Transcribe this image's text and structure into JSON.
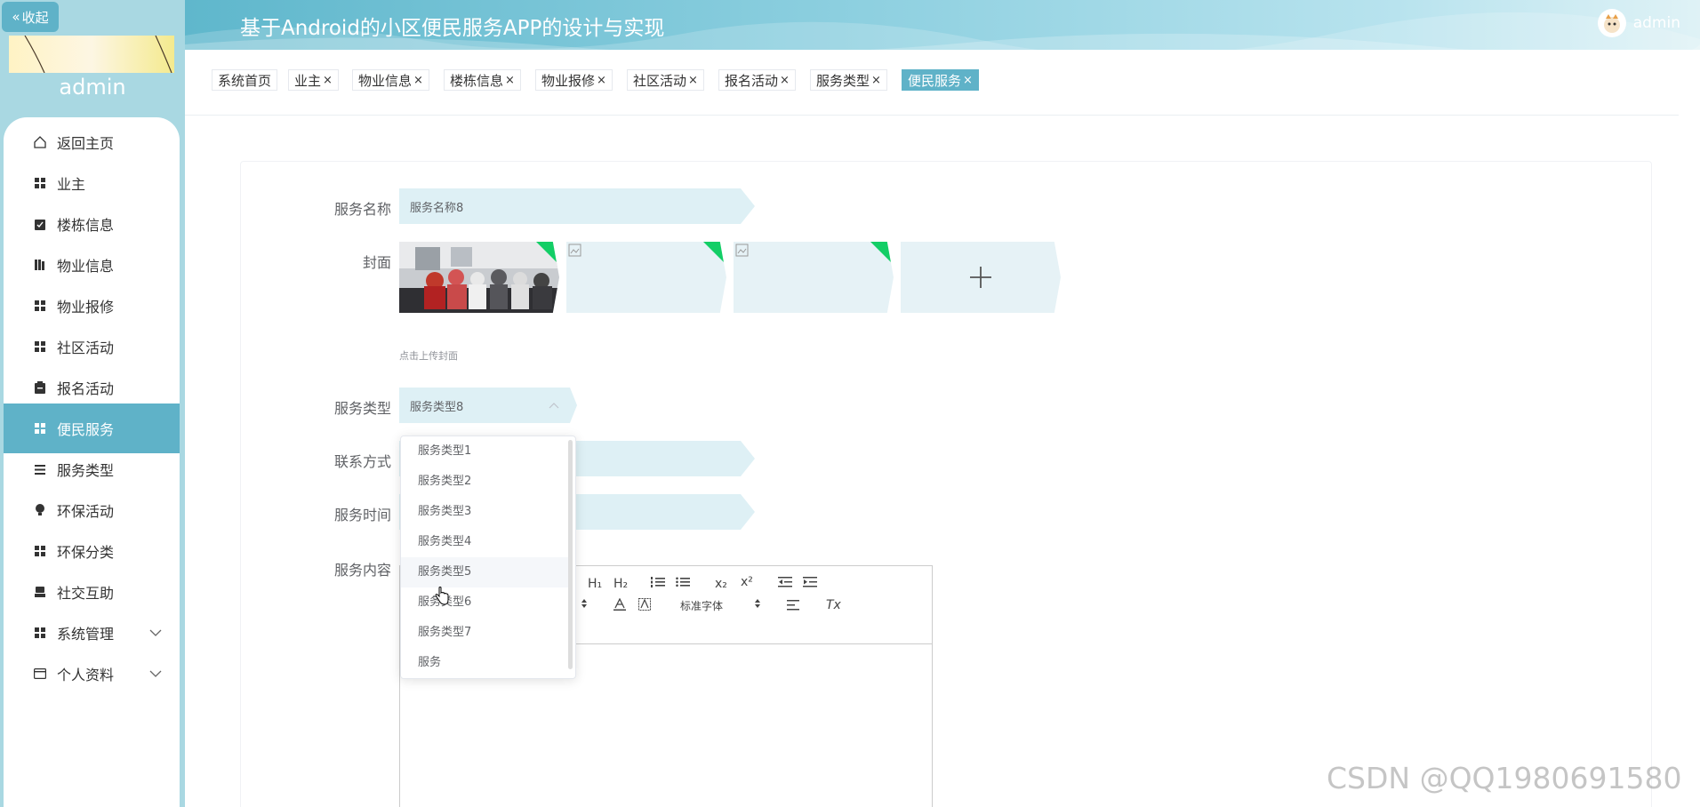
{
  "sidebar": {
    "collapse_label": "收起",
    "username": "admin",
    "items": [
      {
        "label": "返回主页",
        "icon": "home-icon"
      },
      {
        "label": "业主",
        "icon": "grid-icon"
      },
      {
        "label": "楼栋信息",
        "icon": "clipboard-check-icon"
      },
      {
        "label": "物业信息",
        "icon": "books-icon"
      },
      {
        "label": "物业报修",
        "icon": "grid-icon"
      },
      {
        "label": "社区活动",
        "icon": "grid-icon"
      },
      {
        "label": "报名活动",
        "icon": "clipboard-icon"
      },
      {
        "label": "便民服务",
        "icon": "grid-icon",
        "active": true
      },
      {
        "label": "服务类型",
        "icon": "list-icon"
      },
      {
        "label": "环保活动",
        "icon": "bulb-icon"
      },
      {
        "label": "环保分类",
        "icon": "grid-icon"
      },
      {
        "label": "社交互助",
        "icon": "printer-icon"
      },
      {
        "label": "系统管理",
        "icon": "grid-icon"
      },
      {
        "label": "个人资料",
        "icon": "wallet-icon"
      }
    ]
  },
  "header": {
    "title": "基于Android的小区便民服务APP的设计与实现",
    "username": "admin"
  },
  "tags": [
    {
      "label": "系统首页",
      "closable": false
    },
    {
      "label": "业主",
      "closable": true
    },
    {
      "label": "物业信息",
      "closable": true
    },
    {
      "label": "楼栋信息",
      "closable": true
    },
    {
      "label": "物业报修",
      "closable": true
    },
    {
      "label": "社区活动",
      "closable": true
    },
    {
      "label": "报名活动",
      "closable": true
    },
    {
      "label": "服务类型",
      "closable": true
    },
    {
      "label": "便民服务",
      "closable": true,
      "active": true
    }
  ],
  "tag_close_glyph": "×",
  "form": {
    "service_name_label": "服务名称",
    "service_name_value": "服务名称8",
    "cover_label": "封面",
    "cover_hint": "点击上传封面",
    "service_type_label": "服务类型",
    "service_type_value": "服务类型8",
    "contact_label": "联系方式",
    "service_time_label": "服务时间",
    "content_label": "服务内容"
  },
  "dropdown": {
    "options": [
      "服务类型1",
      "服务类型2",
      "服务类型3",
      "服务类型4",
      "服务类型5",
      "服务类型6",
      "服务类型7",
      "服务"
    ],
    "hovered": "服务类型5"
  },
  "editor": {
    "h1": "H₁",
    "h2": "H₂",
    "sub": "x₂",
    "sup": "x²",
    "font_select": "标准字体",
    "clear_format": "Tx"
  },
  "watermark": "CSDN @QQ1980691580",
  "colors": {
    "accent": "#5fb2c8",
    "sidebar_bg": "#a9d8e2",
    "field_bg": "#def0f5",
    "upload_corner": "#13ce66"
  }
}
